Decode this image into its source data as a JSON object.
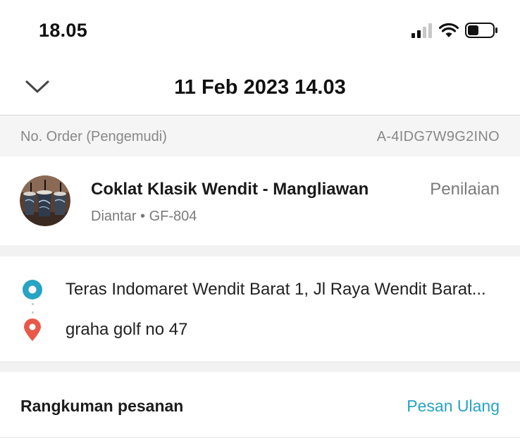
{
  "status_bar": {
    "time": "18.05",
    "icons": [
      "signal-icon",
      "wifi-icon",
      "battery-icon"
    ]
  },
  "header": {
    "title": "11 Feb 2023 14.03",
    "back_icon": "chevron-down-icon"
  },
  "order": {
    "label": "No. Order (Pengemudi)",
    "number": "A-4IDG7W9G2INO"
  },
  "merchant": {
    "name": "Coklat Klasik Wendit - Mangliawan",
    "subtitle": "Diantar • GF-804",
    "rating_label": "Penilaian"
  },
  "route": {
    "pickup": "Teras Indomaret Wendit Barat 1, Jl Raya Wendit Barat...",
    "destination": "graha golf no 47"
  },
  "summary": {
    "title": "Rangkuman pesanan",
    "reorder_label": "Pesan Ulang"
  },
  "colors": {
    "accent": "#27a3c4",
    "pickup": "#27a3c4",
    "destination": "#e8594a",
    "muted_text": "#888888"
  }
}
